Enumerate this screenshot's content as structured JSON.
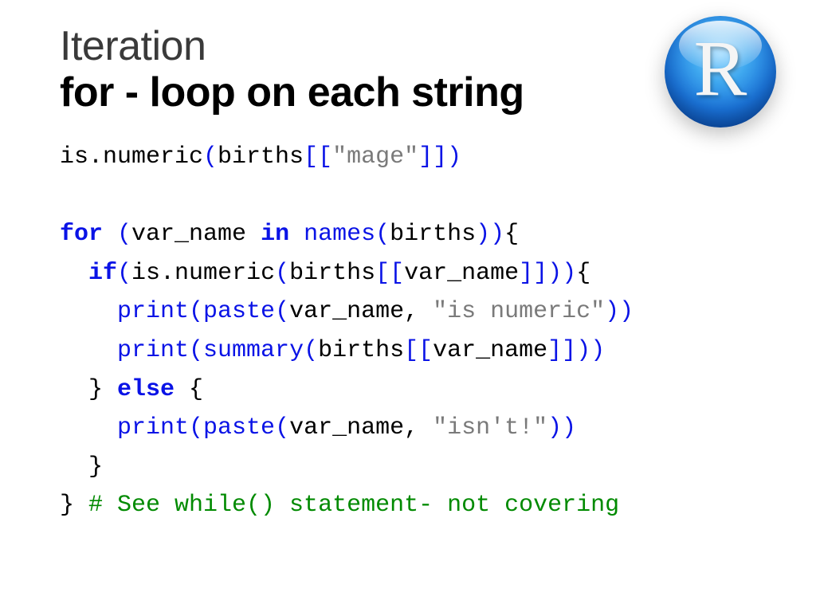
{
  "logo": {
    "letter": "R"
  },
  "title": {
    "line1": "Iteration",
    "line2": "for - loop on each string"
  },
  "code": {
    "l1": {
      "fn1": "is.numeric",
      "po": "(",
      "id1": "births",
      "bo": "[[",
      "str": "\"mage\"",
      "bc": "]]",
      "pc": ")"
    },
    "l2": {
      "kw1": "for ",
      "po1": "(",
      "id1": "var_name ",
      "kw2": "in ",
      "fn1": "names",
      "po2": "(",
      "id2": "births",
      "pc2": "))",
      "brace": "{"
    },
    "l3": {
      "indent": "  ",
      "kw1": "if",
      "po1": "(",
      "id1": "is.numeric",
      "po2": "(",
      "id2": "births",
      "bo": "[[",
      "id3": "var_name",
      "bc": "]]",
      "pc2": "))",
      "brace": "{"
    },
    "l4": {
      "indent": "    ",
      "fn1": "print",
      "po1": "(",
      "fn2": "paste",
      "po2": "(",
      "id1": "var_name",
      "comma": ", ",
      "str": "\"is numeric\"",
      "pc": "))"
    },
    "l5": {
      "indent": "    ",
      "fn1": "print",
      "po1": "(",
      "fn2": "summary",
      "po2": "(",
      "id1": "births",
      "bo": "[[",
      "id2": "var_name",
      "bc": "]]",
      "pc": "))"
    },
    "l6": {
      "indent": "  ",
      "brace1": "} ",
      "kw1": "else ",
      "brace2": "{"
    },
    "l7": {
      "indent": "    ",
      "fn1": "print",
      "po1": "(",
      "fn2": "paste",
      "po2": "(",
      "id1": "var_name",
      "comma": ", ",
      "str": "\"isn't!\"",
      "pc": "))"
    },
    "l8": {
      "indent": "  ",
      "brace": "}"
    },
    "l9": {
      "brace": "} ",
      "comment": "# See while() statement- not covering"
    }
  }
}
